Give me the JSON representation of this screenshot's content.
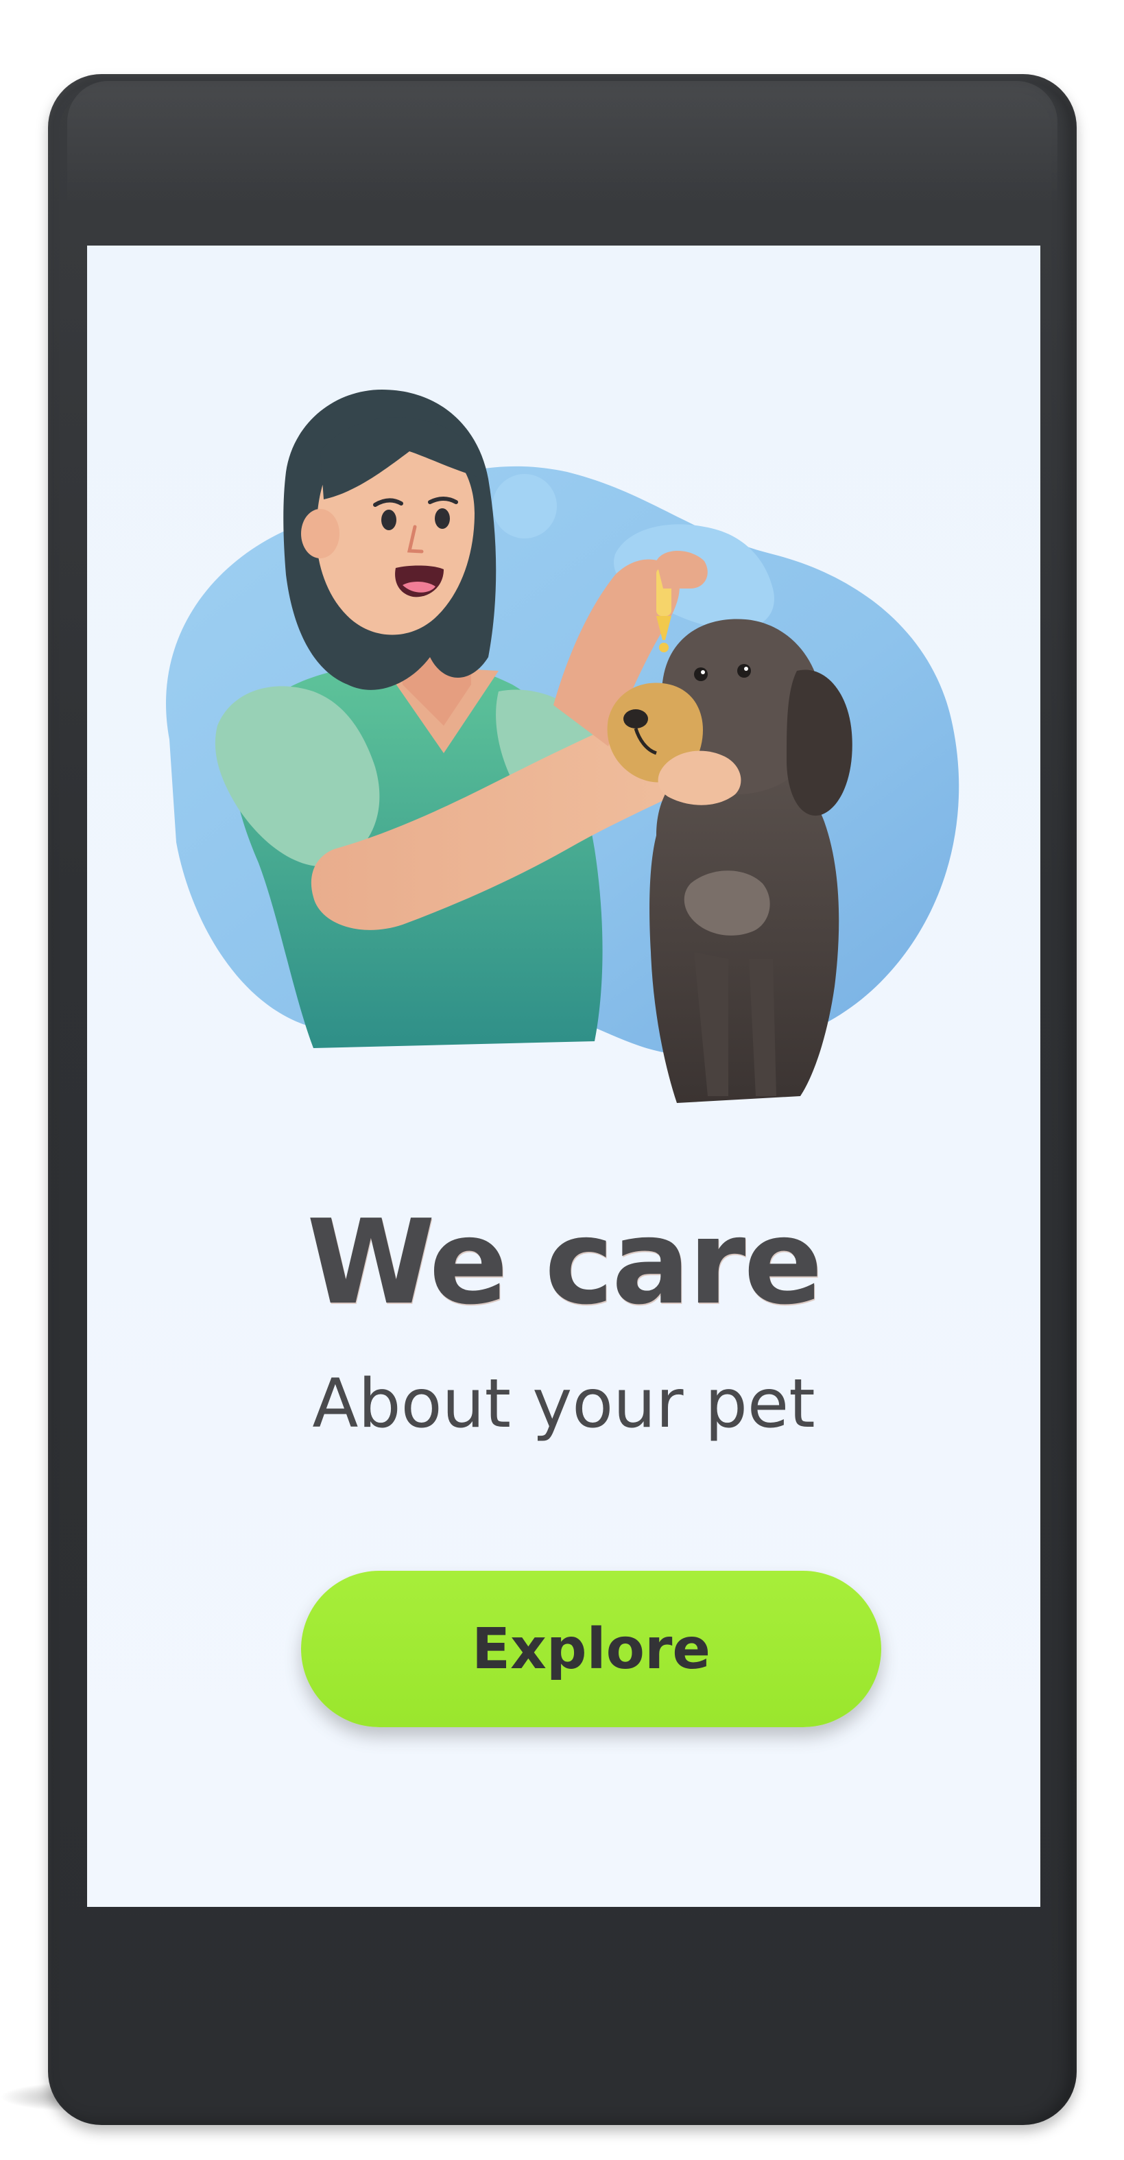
{
  "onboarding": {
    "illustration_icon": "vet-woman-with-dog-illustration",
    "headline": "We care",
    "subheadline": "About your pet",
    "explore_label": "Explore"
  },
  "colors": {
    "phone_frame": "#2f3134",
    "screen_background": "#eef5fd",
    "headline_text": "#4a4a4d",
    "button_background": "#a7ee3a",
    "button_text": "#333336",
    "blob_blue": "#8cc2ec"
  }
}
